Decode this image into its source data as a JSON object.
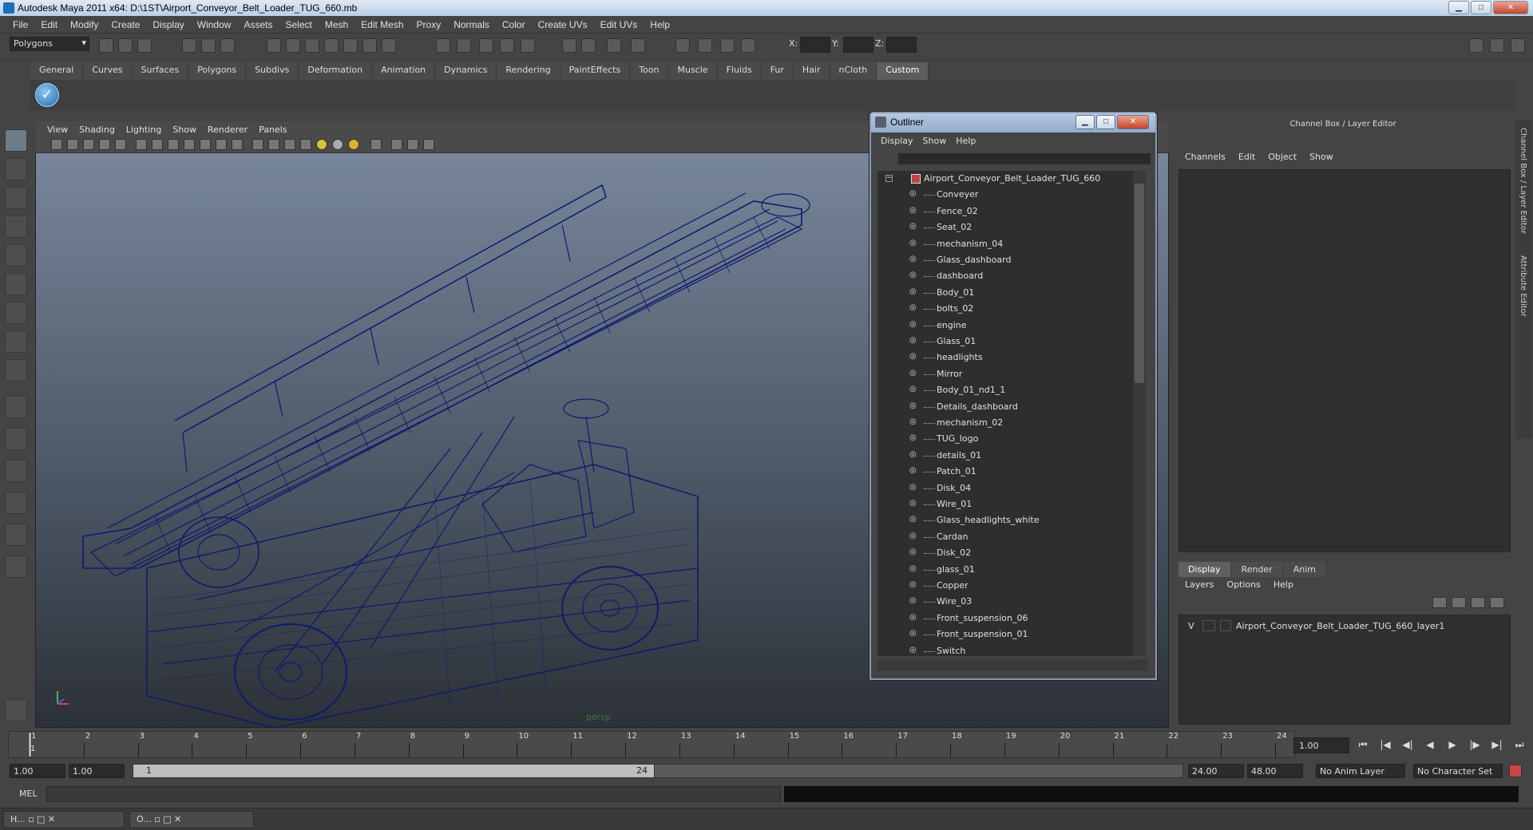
{
  "window": {
    "title": "Autodesk Maya 2011 x64: D:\\1ST\\Airport_Conveyor_Belt_Loader_TUG_660.mb"
  },
  "menubar": [
    "File",
    "Edit",
    "Modify",
    "Create",
    "Display",
    "Window",
    "Assets",
    "Select",
    "Mesh",
    "Edit Mesh",
    "Proxy",
    "Normals",
    "Color",
    "Create UVs",
    "Edit UVs",
    "Help"
  ],
  "statusline": {
    "mode": "Polygons",
    "x_label": "X:",
    "y_label": "Y:",
    "z_label": "Z:"
  },
  "shelf_tabs": [
    "General",
    "Curves",
    "Surfaces",
    "Polygons",
    "Subdivs",
    "Deformation",
    "Animation",
    "Dynamics",
    "Rendering",
    "PaintEffects",
    "Toon",
    "Muscle",
    "Fluids",
    "Fur",
    "Hair",
    "nCloth",
    "Custom"
  ],
  "shelf_active": "Custom",
  "viewport": {
    "menu": [
      "View",
      "Shading",
      "Lighting",
      "Show",
      "Renderer",
      "Panels"
    ],
    "camera": "persp",
    "wire_color": "#0d1a6e"
  },
  "outliner": {
    "title": "Outliner",
    "menu": [
      "Display",
      "Show",
      "Help"
    ],
    "root": "Airport_Conveyor_Belt_Loader_TUG_660",
    "items": [
      "Conveyer",
      "Fence_02",
      "Seat_02",
      "mechanism_04",
      "Glass_dashboard",
      "dashboard",
      "Body_01",
      "bolts_02",
      "engine",
      "Glass_01",
      "headlights",
      "Mirror",
      "Body_01_nd1_1",
      "Details_dashboard",
      "mechanism_02",
      "TUG_logo",
      "details_01",
      "Patch_01",
      "Disk_04",
      "Wire_01",
      "Glass_headlights_white",
      "Cardan",
      "Disk_02",
      "glass_01",
      "Copper",
      "Wire_03",
      "Front_suspension_06",
      "Front_suspension_01",
      "Switch"
    ]
  },
  "channel_box": {
    "header": "Channel Box / Layer Editor",
    "menu": [
      "Channels",
      "Edit",
      "Object",
      "Show"
    ],
    "layer_tabs": [
      "Display",
      "Render",
      "Anim"
    ],
    "layer_tab_active": "Display",
    "layer_menu": [
      "Layers",
      "Options",
      "Help"
    ],
    "layer_visibility": "V",
    "layer_name": "Airport_Conveyor_Belt_Loader_TUG_660_layer1",
    "side_tabs": [
      "Channel Box / Layer Editor",
      "Attribute Editor"
    ]
  },
  "time_slider": {
    "ticks": [
      "1",
      "2",
      "3",
      "4",
      "5",
      "6",
      "7",
      "8",
      "9",
      "10",
      "11",
      "12",
      "13",
      "14",
      "15",
      "16",
      "17",
      "18",
      "19",
      "20",
      "21",
      "22",
      "23",
      "24"
    ],
    "current_frame_marker": "1",
    "current_time": "1.00"
  },
  "range": {
    "start": "1.00",
    "playback_start": "1.00",
    "slider_start": "1",
    "slider_end": "24",
    "playback_end": "24.00",
    "end": "48.00",
    "anim_layer": "No Anim Layer",
    "character_set": "No Character Set"
  },
  "command_line": {
    "label": "MEL"
  },
  "taskbar": [
    {
      "label": "H..."
    },
    {
      "label": "O..."
    }
  ]
}
